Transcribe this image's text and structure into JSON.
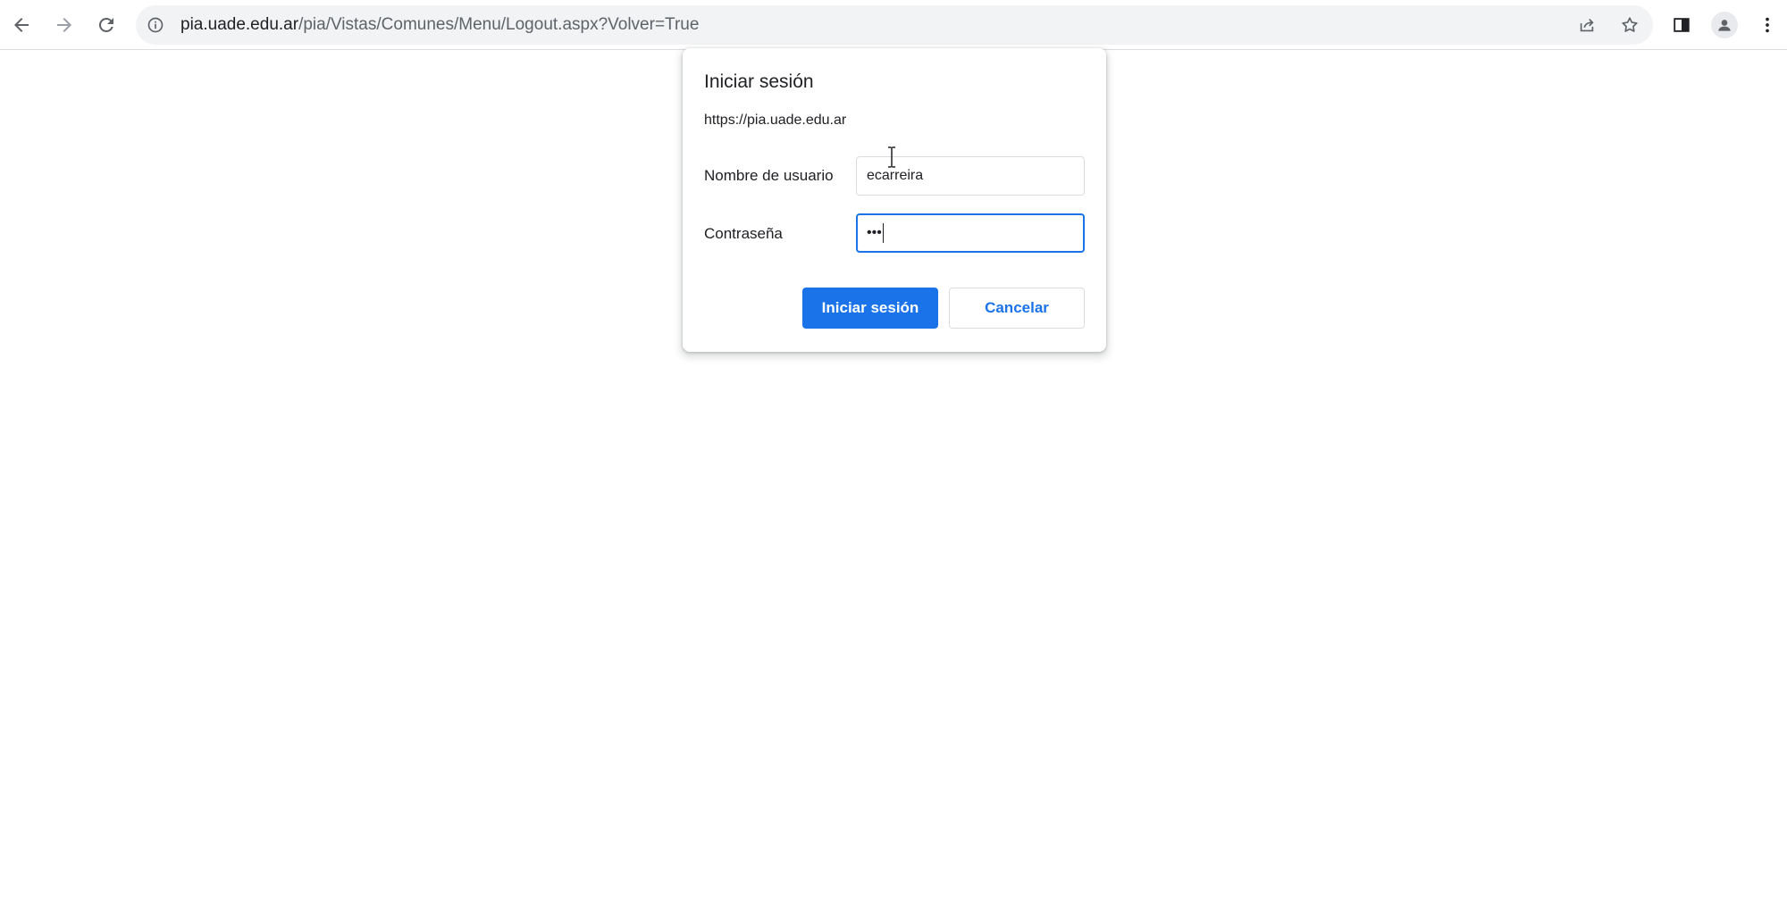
{
  "browser": {
    "url_host": "pia.uade.edu.ar",
    "url_path": "/pia/Vistas/Comunes/Menu/Logout.aspx?Volver=True",
    "icons": {
      "back": "arrow-left-icon",
      "forward": "arrow-right-icon",
      "reload": "reload-icon",
      "site_info": "info-icon",
      "share": "share-icon",
      "bookmark": "star-icon",
      "side_panel": "side-panel-icon",
      "profile": "profile-avatar-icon",
      "menu": "kebab-menu-icon"
    }
  },
  "dialog": {
    "title": "Iniciar sesión",
    "origin": "https://pia.uade.edu.ar",
    "username_label": "Nombre de usuario",
    "username_value": "ecarreira",
    "password_label": "Contraseña",
    "password_mask": "•••",
    "submit_label": "Iniciar sesión",
    "cancel_label": "Cancelar"
  },
  "colors": {
    "accent": "#1a73e8",
    "omnibox_bg": "#f1f3f4",
    "icon": "#5f6368"
  }
}
